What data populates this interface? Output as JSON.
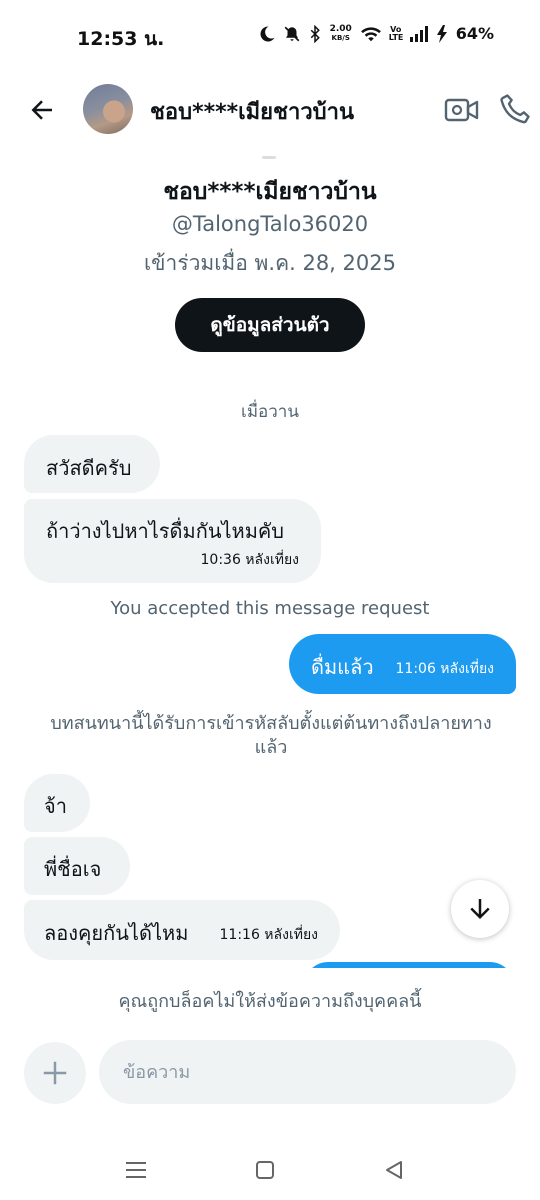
{
  "status_bar": {
    "time": "12:53 น.",
    "net_speed_value": "2.00",
    "net_speed_unit": "KB/S",
    "volte": "Vo LTE",
    "battery": "64%"
  },
  "header": {
    "name": "ชอบ****เมียชาวบ้าน"
  },
  "profile": {
    "name": "ชอบ****เมียชาวบ้าน",
    "handle": "@TalongTalo36020",
    "joined": "เข้าร่วมเมื่อ พ.ค. 28, 2025",
    "view_profile_button": "ดูข้อมูลส่วนตัว"
  },
  "conversation": {
    "date_separator": "เมื่อวาน",
    "messages_group1": [
      {
        "text": "สวัสดีครับ"
      },
      {
        "text": "ถ้าว่างไปหาไรดื่มกันไหมคับ",
        "time": "10:36 หลังเที่ยง"
      }
    ],
    "accepted_notice": "You accepted this message request",
    "outgoing": {
      "text": "ดื่มแล้ว",
      "time": "11:06 หลังเที่ยง"
    },
    "encryption_notice": "บทสนทนานี้ได้รับการเข้ารหัสลับตั้งแต่ต้นทางถึงปลายทางแล้ว",
    "messages_group2": [
      {
        "text": "จ้า"
      },
      {
        "text": "พี่ชื่อเจ"
      },
      {
        "text": "ลองคุยกันได้ไหม",
        "time": "11:16 หลังเที่ยง"
      }
    ]
  },
  "blocked_notice": "คุณถูกบล็อคไม่ให้ส่งข้อความถึงบุคคลนี้",
  "composer": {
    "placeholder": "ข้อความ"
  },
  "colors": {
    "accent": "#1d9bf0",
    "incoming_bubble": "#eff3f4",
    "secondary_text": "#536471"
  }
}
